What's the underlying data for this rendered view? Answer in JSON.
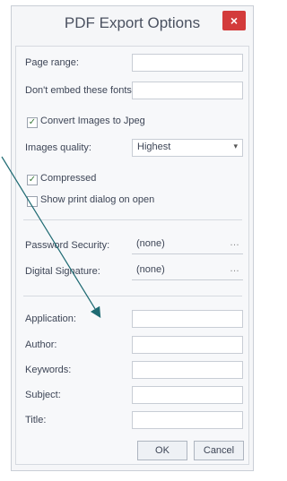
{
  "dialog": {
    "title": "PDF Export Options",
    "close_label": "×"
  },
  "fields": {
    "page_range_label": "Page range:",
    "page_range_value": "",
    "dont_embed_label": "Don't embed these fonts:",
    "dont_embed_value": "",
    "convert_images_label": "Convert Images to Jpeg",
    "convert_images_checked": true,
    "images_quality_label": "Images quality:",
    "images_quality_value": "Highest",
    "compressed_label": "Compressed",
    "compressed_checked": true,
    "show_print_label": "Show print dialog on open",
    "show_print_checked": false,
    "password_label": "Password Security:",
    "password_value": "(none)",
    "signature_label": "Digital Signature:",
    "signature_value": "(none)",
    "application_label": "Application:",
    "author_label": "Author:",
    "keywords_label": "Keywords:",
    "subject_label": "Subject:",
    "title_label": "Title:"
  },
  "buttons": {
    "ok": "OK",
    "cancel": "Cancel"
  },
  "glyphs": {
    "check": "✓",
    "dropdown": "▾",
    "more": "…"
  },
  "colors": {
    "close_button": "#d33b3b",
    "annotation_arrow": "#1f6b73"
  }
}
